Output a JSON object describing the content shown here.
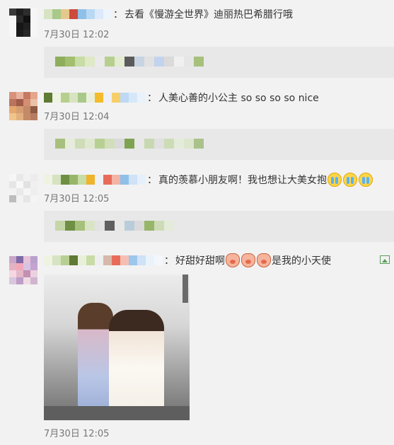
{
  "comments": [
    {
      "message": "去看《慢游全世界》迪丽热巴希腊行哦",
      "time": "7月30日 12:02"
    },
    {
      "message": "人美心善的小公主  so so so so nice",
      "time": "7月30日 12:04"
    },
    {
      "message": "真的羡慕小朋友啊！我也想让大美女抱",
      "time": "7月30日 12:05"
    },
    {
      "message_part1": "好甜好甜啊",
      "message_part2": "是我的小天使",
      "time": "7月30日 12:05"
    }
  ],
  "separator": "：",
  "icons": {
    "emoji_cry": "crying-emoji",
    "emoji_pig": "pig-emoji",
    "image": "image-icon"
  }
}
